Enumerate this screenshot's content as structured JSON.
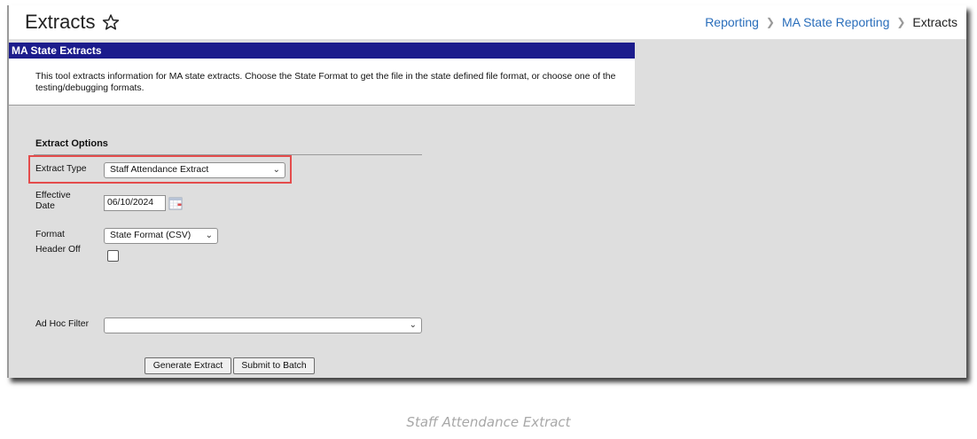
{
  "page": {
    "title": "Extracts",
    "caption": "Staff Attendance Extract"
  },
  "breadcrumb": {
    "items": [
      "Reporting",
      "MA State Reporting",
      "Extracts"
    ]
  },
  "section": {
    "header": "MA State Extracts",
    "description": "This tool extracts information for MA state extracts. Choose the State Format to get the file in the state defined file format, or choose one of the testing/debugging formats."
  },
  "options": {
    "heading": "Extract Options",
    "extract_type": {
      "label": "Extract Type",
      "value": "Staff Attendance Extract"
    },
    "effective_date": {
      "label_line1": "Effective",
      "label_line2": "Date",
      "value": "06/10/2024"
    },
    "format": {
      "label": "Format",
      "value": "State Format (CSV)"
    },
    "header_off": {
      "label": "Header Off",
      "checked": false
    },
    "ad_hoc_filter": {
      "label": "Ad Hoc Filter",
      "value": ""
    }
  },
  "buttons": {
    "generate": "Generate Extract",
    "submit": "Submit to Batch"
  },
  "icons": {
    "star": "star-outline-icon",
    "calendar": "calendar-icon",
    "chevron": "chevron-down-icon",
    "breadcrumb_separator": "chevron-right-icon"
  },
  "colors": {
    "section_header_bg": "#1c1c8c",
    "highlight_border": "#e44c4c",
    "link": "#2a6ebb",
    "panel_bg": "#dedede"
  }
}
